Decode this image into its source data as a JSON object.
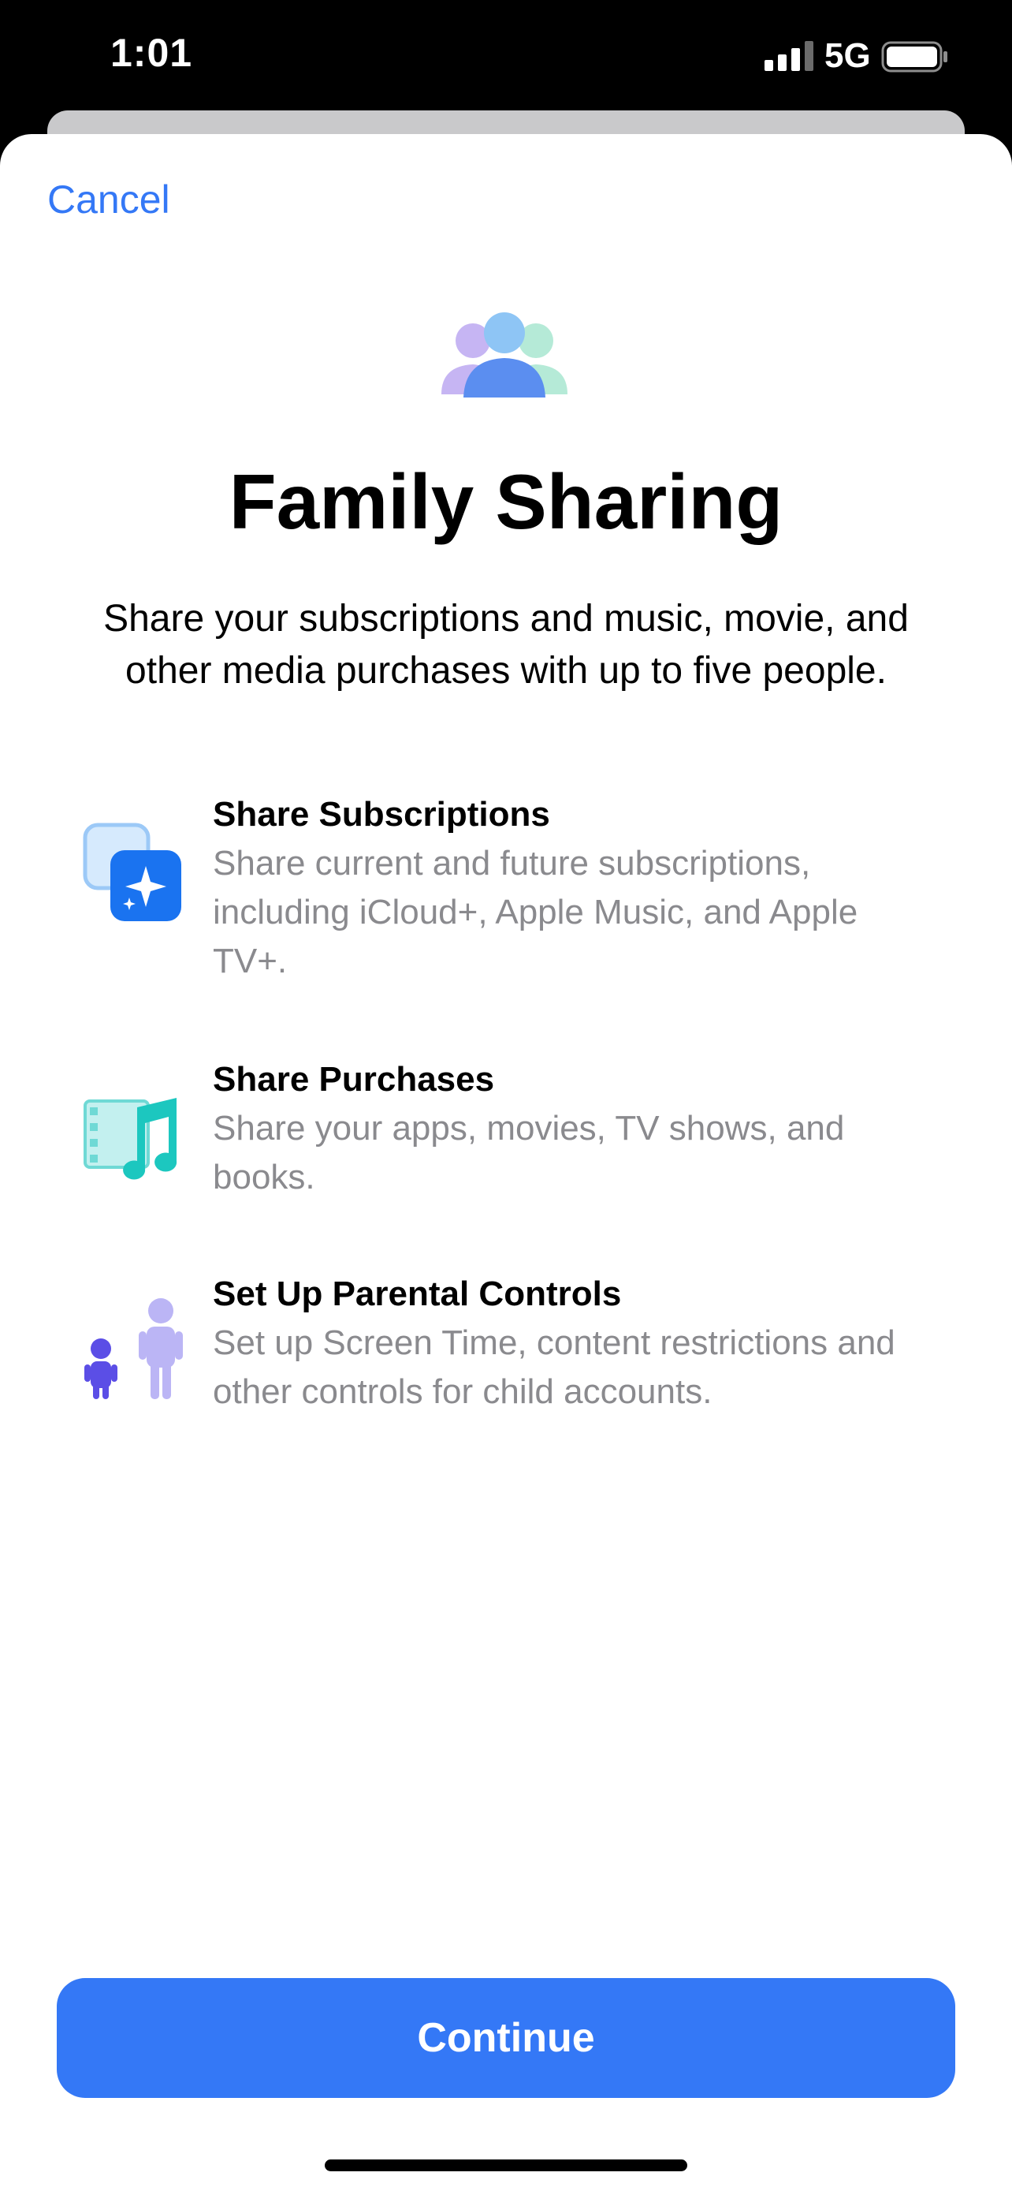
{
  "status_bar": {
    "time": "1:01",
    "network": "5G",
    "signal_icon": "cellular-signal-icon",
    "battery_icon": "battery-icon"
  },
  "header": {
    "cancel_label": "Cancel"
  },
  "hero": {
    "icon": "family-people-icon",
    "title": "Family Sharing",
    "subtitle": "Share your subscriptions and music, movie, and other media purchases with up to five people."
  },
  "features": [
    {
      "icon": "subscriptions-icon",
      "title": "Share Subscriptions",
      "description": "Share current and future subscriptions, including iCloud+, Apple Music, and Apple TV+."
    },
    {
      "icon": "purchases-music-film-icon",
      "title": "Share Purchases",
      "description": "Share your apps, movies, TV shows, and books."
    },
    {
      "icon": "parental-controls-icon",
      "title": "Set Up Parental Controls",
      "description": "Set up Screen Time, content restrictions and other controls for child accounts."
    }
  ],
  "footer": {
    "continue_label": "Continue"
  },
  "colors": {
    "accent": "#3478f6",
    "secondary_text": "#8a8a8e",
    "sheet_background": "#ffffff",
    "status_bar_background": "#000000"
  }
}
